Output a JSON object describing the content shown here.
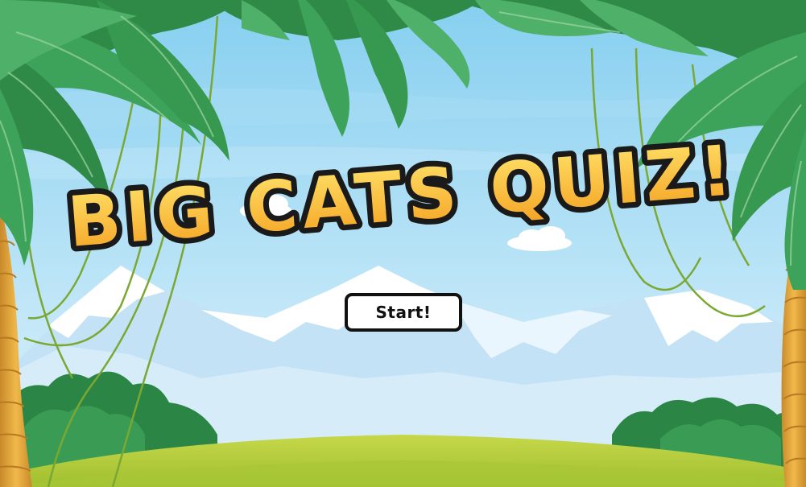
{
  "game": {
    "title": "BIG CATS QUIZ!",
    "start_label": "Start!"
  },
  "colors": {
    "sky_top": "#8ed4f2",
    "sky_bottom": "#dff2fb",
    "mountain": "#c9e6f6",
    "snow": "#ffffff",
    "bush": "#2f8a46",
    "grass": "#b7cf3c",
    "palm_leaf": "#3c9b57",
    "palm_trunk": "#e0a43b",
    "vine": "#7ba935",
    "title_fill_top": "#ffe066",
    "title_fill_bottom": "#f5a623",
    "title_outline": "#1a1a1a"
  },
  "scene": {
    "decor": [
      "sky",
      "clouds",
      "snowy-mountains",
      "jungle-bushes",
      "grass-hill",
      "palm-trees",
      "hanging-vines"
    ]
  }
}
